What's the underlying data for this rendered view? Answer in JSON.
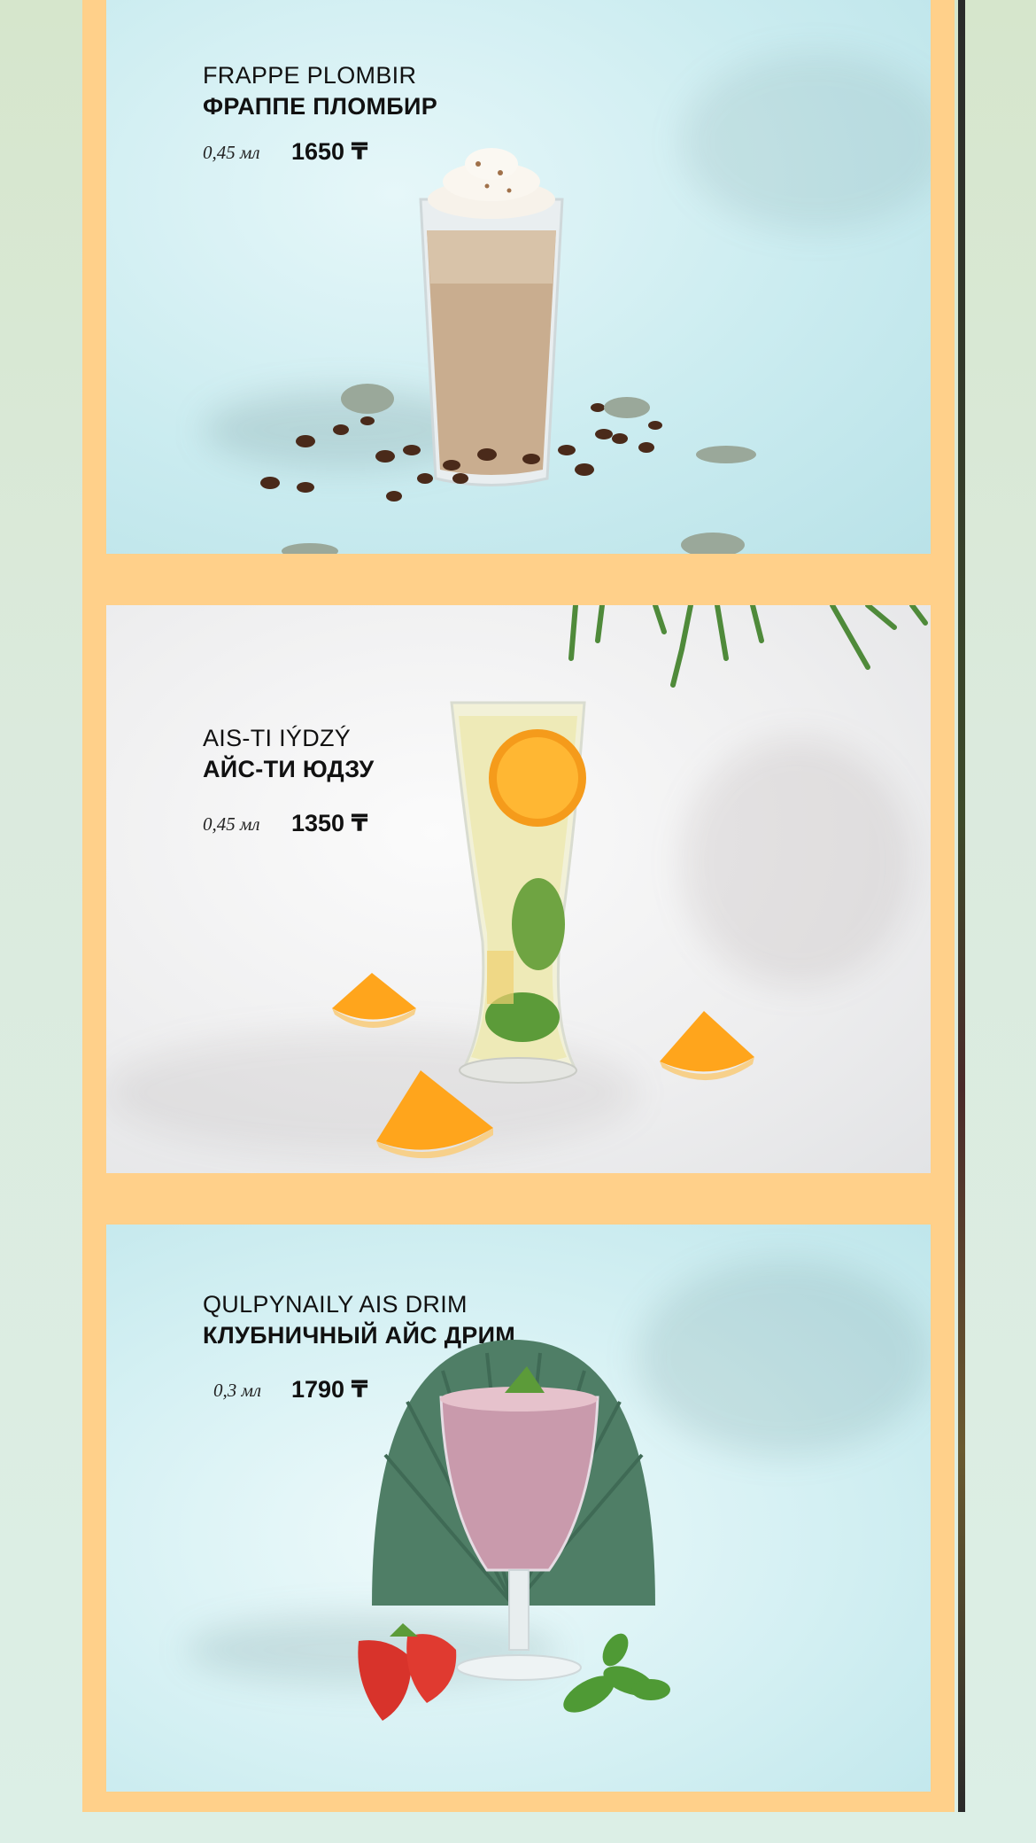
{
  "menu": {
    "items": [
      {
        "name_latin": "FRAPPE PLOMBIR",
        "name_cyrillic": "ФРАППЕ ПЛОМБИР",
        "volume": "0,45 мл",
        "price": "1650 ₸",
        "photo_icon": "frappe-glass-photo"
      },
      {
        "name_latin": "AIS-TI IÝDZÝ",
        "name_cyrillic": "АЙС-ТИ ЮДЗУ",
        "volume": "0,45 мл",
        "price": "1350 ₸",
        "photo_icon": "iced-tea-glass-photo"
      },
      {
        "name_latin": "QULPYNAILY AIS DRIM",
        "name_cyrillic": "КЛУБНИЧНЫЙ АЙС ДРИМ",
        "volume": "0,3 мл",
        "price": "1790 ₸",
        "photo_icon": "strawberry-dream-glass-photo"
      }
    ]
  },
  "colors": {
    "frame": "#ffd08a",
    "page_background": "#dbeadd",
    "text": "#111111"
  }
}
